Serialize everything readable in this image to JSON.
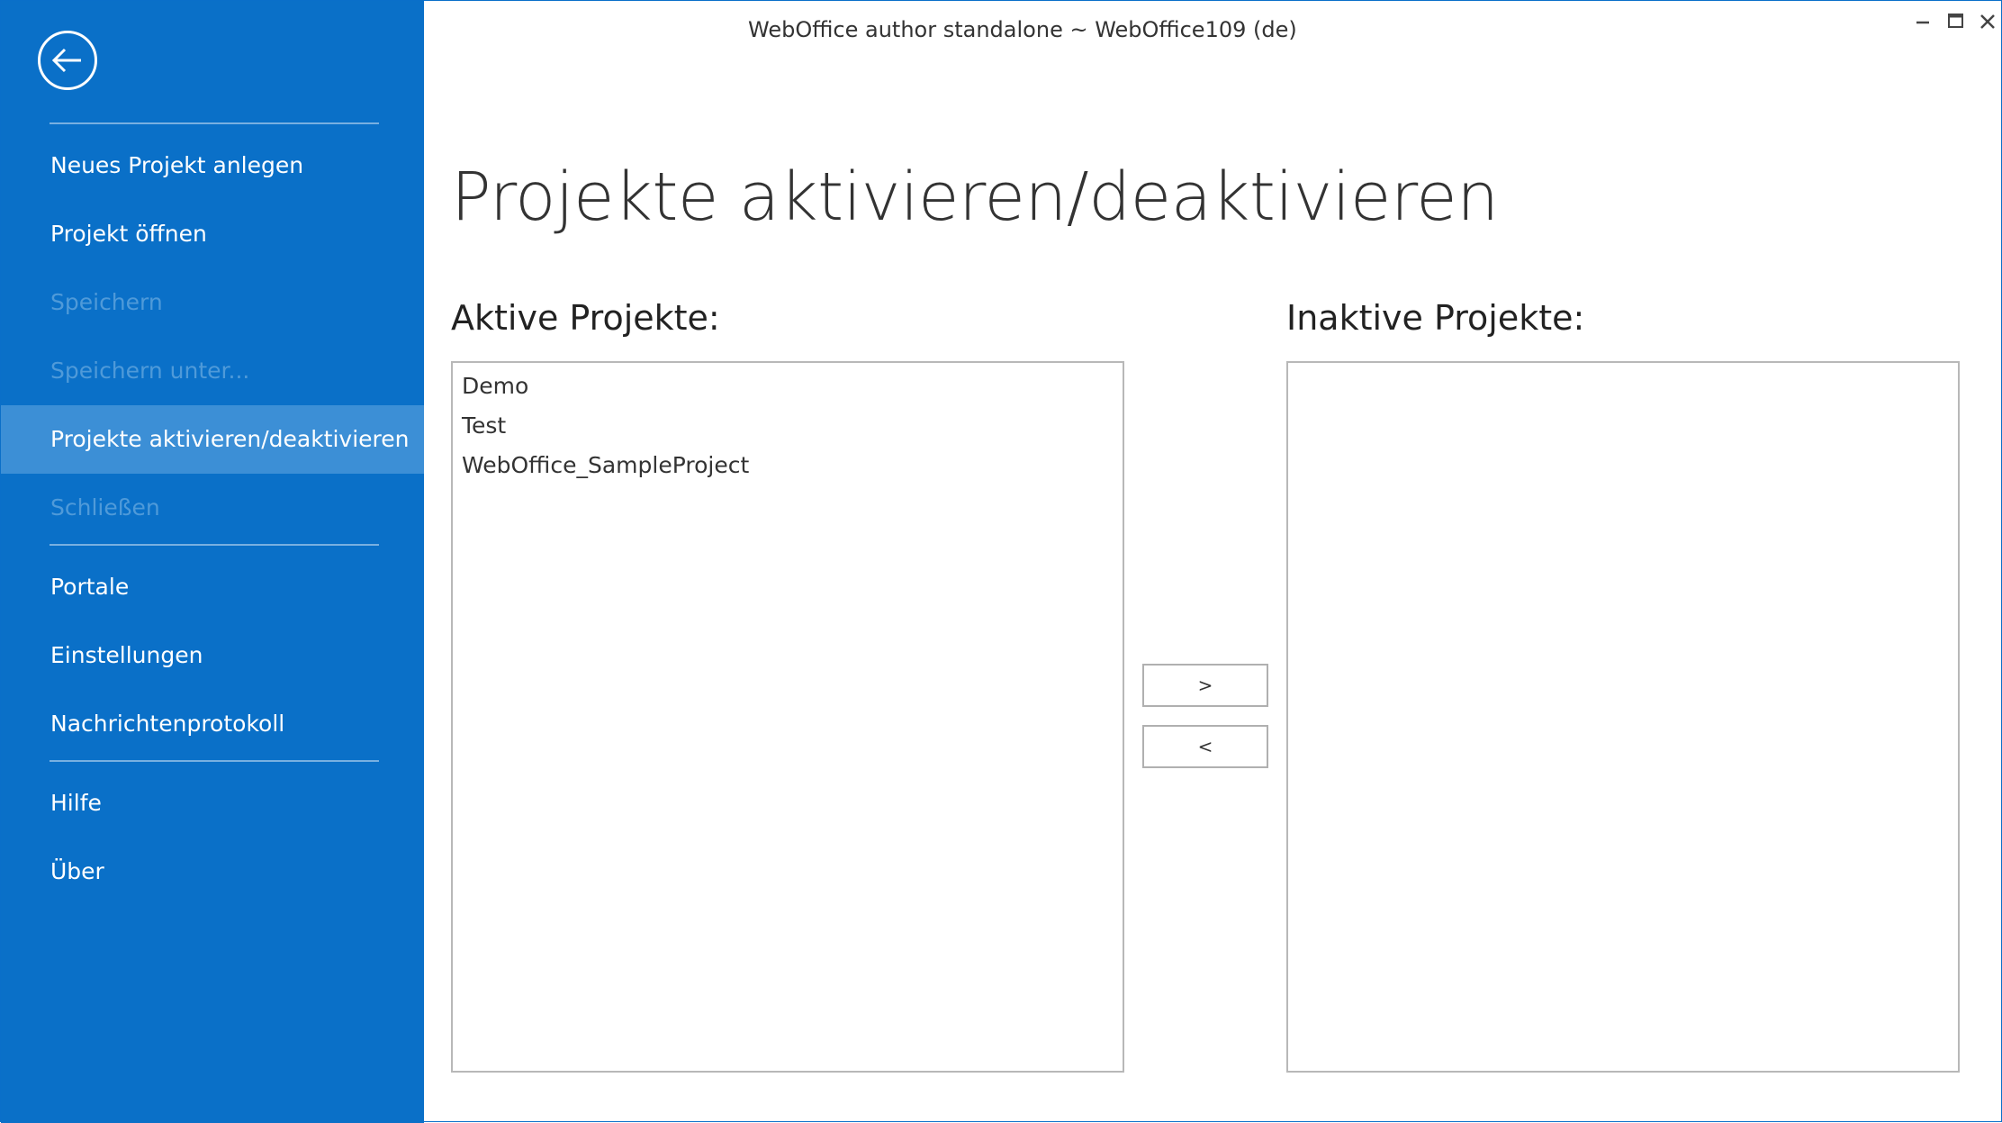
{
  "window": {
    "title": "WebOffice author standalone ~ WebOffice109 (de)",
    "controls": [
      "minimize-icon",
      "maximize-icon",
      "close-icon"
    ]
  },
  "colors": {
    "sidebar_bg": "#0a70c8",
    "sidebar_selected_bg": "#3c8fd6",
    "sidebar_disabled_text": "#4f9ad9"
  },
  "sidebar": {
    "back_icon": "back-arrow-icon",
    "items": [
      {
        "label": "Neues Projekt anlegen",
        "enabled": true,
        "selected": false
      },
      {
        "label": "Projekt öffnen",
        "enabled": true,
        "selected": false
      },
      {
        "label": "Speichern",
        "enabled": false,
        "selected": false
      },
      {
        "label": "Speichern unter...",
        "enabled": false,
        "selected": false
      },
      {
        "label": "Projekte aktivieren/deaktivieren",
        "enabled": true,
        "selected": true
      },
      {
        "label": "Schließen",
        "enabled": false,
        "selected": false
      },
      {
        "label": "Portale",
        "enabled": true,
        "selected": false
      },
      {
        "label": "Einstellungen",
        "enabled": true,
        "selected": false
      },
      {
        "label": "Nachrichtenprotokoll",
        "enabled": true,
        "selected": false
      },
      {
        "label": "Hilfe",
        "enabled": true,
        "selected": false
      },
      {
        "label": "Über",
        "enabled": true,
        "selected": false
      }
    ]
  },
  "main": {
    "title": "Projekte aktivieren/deaktivieren",
    "active": {
      "label": "Aktive Projekte:",
      "items": [
        "Demo",
        "Test",
        "WebOffice_SampleProject"
      ]
    },
    "inactive": {
      "label": "Inaktive Projekte:",
      "items": []
    },
    "buttons": {
      "deactivate": ">",
      "activate": "<"
    }
  }
}
